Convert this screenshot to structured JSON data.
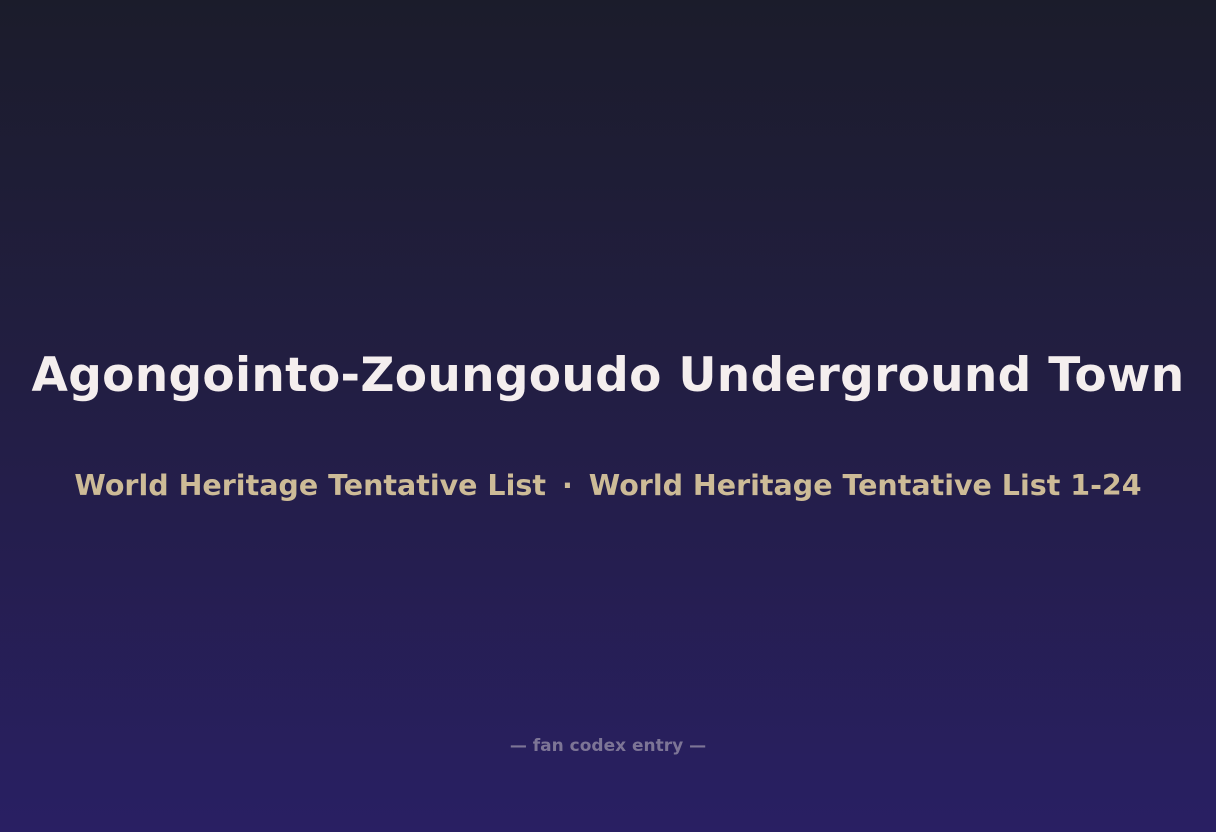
{
  "title": "Agongointo-Zoungoudo Underground Town",
  "subtitle": {
    "left": "World Heritage Tentative List",
    "separator": "·",
    "right": "World Heritage Tentative List 1-24"
  },
  "footer": "— fan codex entry —",
  "colors": {
    "background_top": "#1b1c2b",
    "background_bottom": "#291f63",
    "title": "#f4eeee",
    "subtitle": "#cdbb97",
    "footer": "#7d7596"
  }
}
